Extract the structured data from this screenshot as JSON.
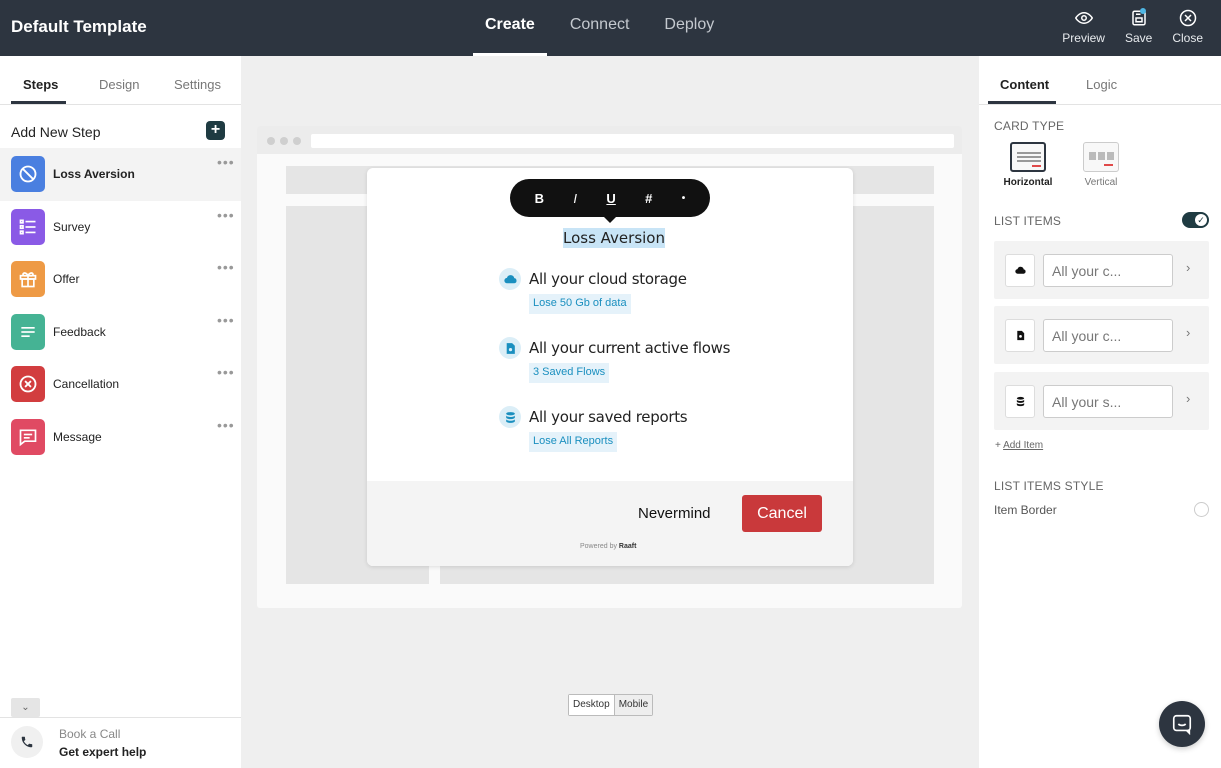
{
  "app": {
    "title": "Default Template"
  },
  "topnav": [
    {
      "label": "Create",
      "active": true
    },
    {
      "label": "Connect",
      "active": false
    },
    {
      "label": "Deploy",
      "active": false
    }
  ],
  "actions": {
    "preview": "Preview",
    "save": "Save",
    "close": "Close"
  },
  "left": {
    "tabs": [
      "Steps",
      "Design",
      "Settings"
    ],
    "add_step_label": "Add New Step",
    "add_symbol": "+",
    "steps": [
      {
        "label": "Loss Aversion",
        "icon": "ban-icon",
        "color": "#4a7fe0"
      },
      {
        "label": "Survey",
        "icon": "list-icon",
        "color": "#8a5ae6"
      },
      {
        "label": "Offer",
        "icon": "gift-icon",
        "color": "#ee9a45"
      },
      {
        "label": "Feedback",
        "icon": "text-lines-icon",
        "color": "#45b394"
      },
      {
        "label": "Cancellation",
        "icon": "cancel-circle-icon",
        "color": "#d23d3f"
      },
      {
        "label": "Message",
        "icon": "chat-icon",
        "color": "#e04a63"
      }
    ],
    "book_call": {
      "line1": "Book a Call",
      "line2": "Get expert help"
    }
  },
  "modal": {
    "toolbar": {
      "bold": "B",
      "italic": "I",
      "underline": "U",
      "hash": "#",
      "dot": "•"
    },
    "title": "Loss Aversion",
    "items": [
      {
        "title": "All your cloud storage",
        "sub": "Lose 50 Gb of data",
        "icon": "cloud-icon"
      },
      {
        "title": "All your current active flows",
        "sub": "3 Saved Flows",
        "icon": "file-flow-icon"
      },
      {
        "title": "All your saved reports",
        "sub": "Lose All Reports",
        "icon": "database-icon"
      }
    ],
    "nevermind": "Nevermind",
    "cancel": "Cancel",
    "powered_by": "Powered by",
    "brand": "Raaft"
  },
  "device_toggle": {
    "desktop": "Desktop",
    "mobile": "Mobile"
  },
  "right": {
    "tabs": [
      "Content",
      "Logic"
    ],
    "card_type_heading": "CARD TYPE",
    "card_types": [
      {
        "label": "Horizontal",
        "selected": true
      },
      {
        "label": "Vertical",
        "selected": false
      }
    ],
    "list_items_heading": "LIST ITEMS",
    "list_items_enabled": true,
    "list_items": [
      {
        "value": "All your c...",
        "icon": "cloud-icon"
      },
      {
        "value": "All your c...",
        "icon": "file-flow-icon"
      },
      {
        "value": "All your s...",
        "icon": "database-icon"
      }
    ],
    "add_item": "Add Item",
    "list_style_heading": "LIST ITEMS STYLE",
    "item_border_label": "Item Border"
  },
  "colors": {
    "topbar": "#2d3540",
    "accent": "#1f3b42",
    "cancel": "#c9393b",
    "highlight": "#c8e4f6"
  }
}
